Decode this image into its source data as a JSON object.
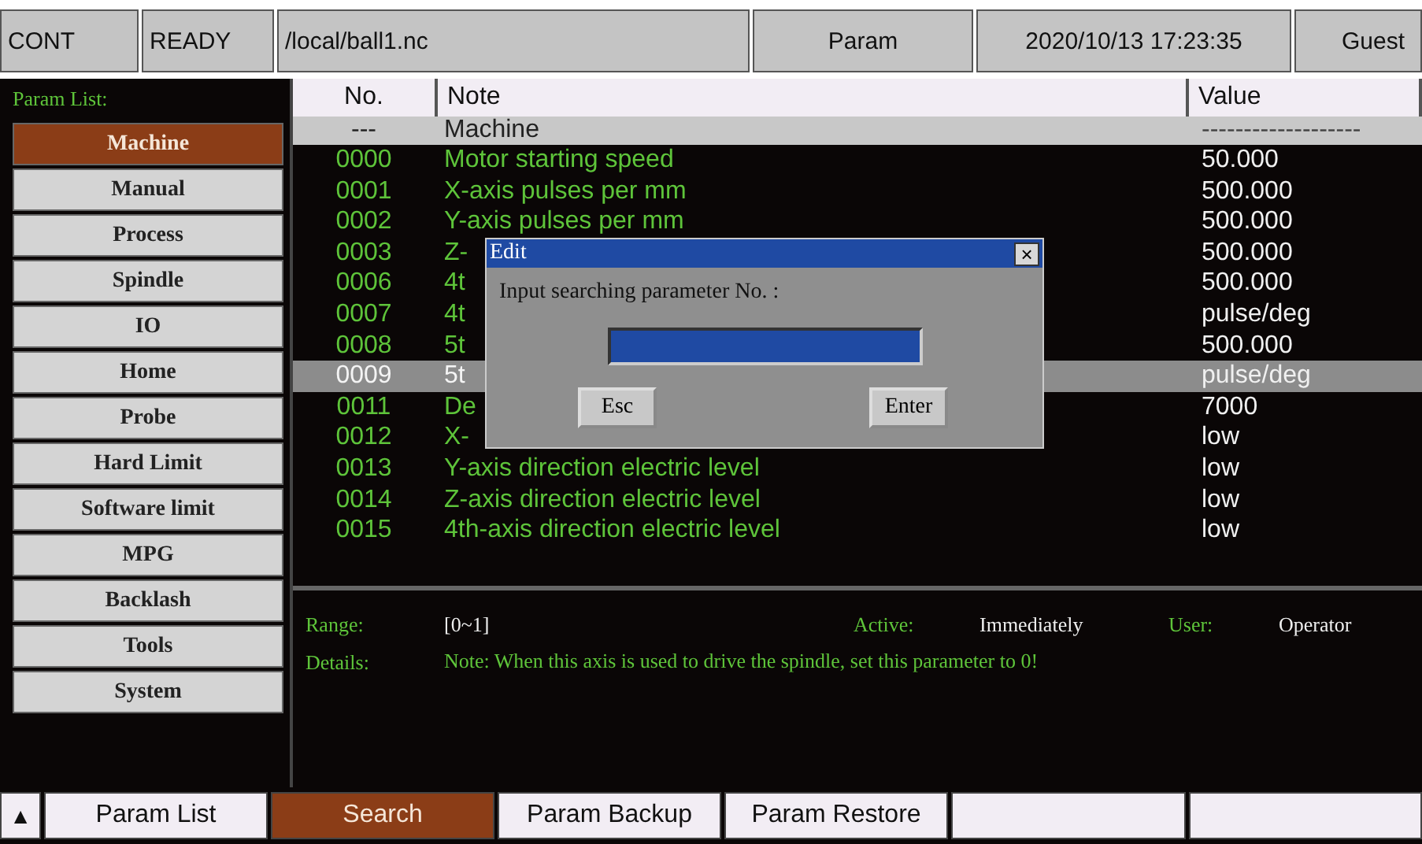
{
  "status_bar": {
    "mode": "CONT",
    "state": "READY",
    "file": "/local/ball1.nc",
    "page": "Param",
    "datetime": "2020/10/13 17:23:35",
    "user": "Guest"
  },
  "sidebar": {
    "title": "Param List:",
    "items": [
      {
        "label": "Machine",
        "selected": true
      },
      {
        "label": "Manual",
        "selected": false
      },
      {
        "label": "Process",
        "selected": false
      },
      {
        "label": "Spindle",
        "selected": false
      },
      {
        "label": "IO",
        "selected": false
      },
      {
        "label": "Home",
        "selected": false
      },
      {
        "label": "Probe",
        "selected": false
      },
      {
        "label": "Hard Limit",
        "selected": false
      },
      {
        "label": "Software limit",
        "selected": false
      },
      {
        "label": "MPG",
        "selected": false
      },
      {
        "label": "Backlash",
        "selected": false
      },
      {
        "label": "Tools",
        "selected": false
      },
      {
        "label": "System",
        "selected": false
      }
    ]
  },
  "table": {
    "columns": [
      "No.",
      "Note",
      "Value"
    ],
    "rows": [
      {
        "kind": "group",
        "no": "---",
        "note": "Machine",
        "value": "-------------------",
        "selected": false
      },
      {
        "kind": "param",
        "no": "0000",
        "note": "Motor starting speed",
        "value": "50.000",
        "selected": false
      },
      {
        "kind": "param",
        "no": "0001",
        "note": "X-axis pulses per mm",
        "value": "500.000",
        "selected": false
      },
      {
        "kind": "param",
        "no": "0002",
        "note": "Y-axis pulses per mm",
        "value": "500.000",
        "selected": false
      },
      {
        "kind": "param",
        "no": "0003",
        "note": "Z-",
        "value": "500.000",
        "selected": false
      },
      {
        "kind": "param",
        "no": "0006",
        "note": "4t",
        "value": "500.000",
        "selected": false
      },
      {
        "kind": "param",
        "no": "0007",
        "note": "4t",
        "value": "pulse/deg",
        "selected": false
      },
      {
        "kind": "param",
        "no": "0008",
        "note": "5t",
        "value": "500.000",
        "selected": false
      },
      {
        "kind": "param",
        "no": "0009",
        "note": "5t",
        "value": "pulse/deg",
        "selected": true
      },
      {
        "kind": "param",
        "no": "0011",
        "note": "De",
        "value": "7000",
        "selected": false
      },
      {
        "kind": "param",
        "no": "0012",
        "note": "X-",
        "value": "low",
        "selected": false
      },
      {
        "kind": "param",
        "no": "0013",
        "note": "Y-axis direction electric level",
        "value": "low",
        "selected": false
      },
      {
        "kind": "param",
        "no": "0014",
        "note": "Z-axis direction electric level",
        "value": "low",
        "selected": false
      },
      {
        "kind": "param",
        "no": "0015",
        "note": "4th-axis direction electric level",
        "value": "low",
        "selected": false
      }
    ]
  },
  "details": {
    "range_label": "Range:",
    "range": "[0~1]",
    "active_label": "Active:",
    "active": "Immediately",
    "user_label": "User:",
    "user": "Operator",
    "details_label": "Details:",
    "details": "Note: When this axis is used to drive the spindle, set this parameter to 0!"
  },
  "dialog": {
    "title": "Edit",
    "close": "×",
    "prompt": "Input searching parameter No. :",
    "value_focused": true,
    "buttons": [
      "Esc",
      "Enter"
    ]
  },
  "softkeys": [
    {
      "label": "▲",
      "kind": "icon",
      "selected": false
    },
    {
      "label": "Param List",
      "kind": "text",
      "selected": false
    },
    {
      "label": "Search",
      "kind": "text",
      "selected": true
    },
    {
      "label": "Param Backup",
      "kind": "text",
      "selected": false
    },
    {
      "label": "Param Restore",
      "kind": "text",
      "selected": false
    },
    {
      "kind": "blank",
      "selected": false
    },
    {
      "kind": "blank",
      "selected": false
    }
  ]
}
